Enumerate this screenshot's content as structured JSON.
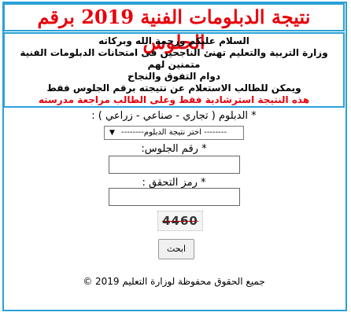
{
  "header": {
    "title": "نتيجة الدبلومات الفنية 2019 برقم الجلوس"
  },
  "info": {
    "line1": "السلام عليكم ورحمة الله وبركاته",
    "line2": "وزارة التربية والتعليم تهنئ الناجحين فى امتحانات الدبلومات الفنية متمنين لهم",
    "line3": "دوام التفوق والنجاح",
    "line4": "ويمكن للطالب الاستعلام عن نتيجته برقم الجلوس فقط",
    "warning": "هذه النتيجة استرشادية فقط وعلى الطالب مراجعة مدرسته"
  },
  "form": {
    "diploma_label": "* الدبلوم ( تجاري - صناعي - زراعي ) :",
    "diploma_selected": "-------- اختر نتيجة الدبلوم--------",
    "seat_label": "* رقم الجلوس:",
    "seat_value": "",
    "captcha_label": "* رمز التحقق :",
    "captcha_value": "",
    "captcha_text": "4460",
    "search_button": "ابحث"
  },
  "footer": {
    "copyright": "جميع الحقوق محفوظة لوزارة التعليم 2019 ©"
  },
  "colors": {
    "accent_border": "#2aa1d8",
    "title_red": "#e8000b"
  }
}
